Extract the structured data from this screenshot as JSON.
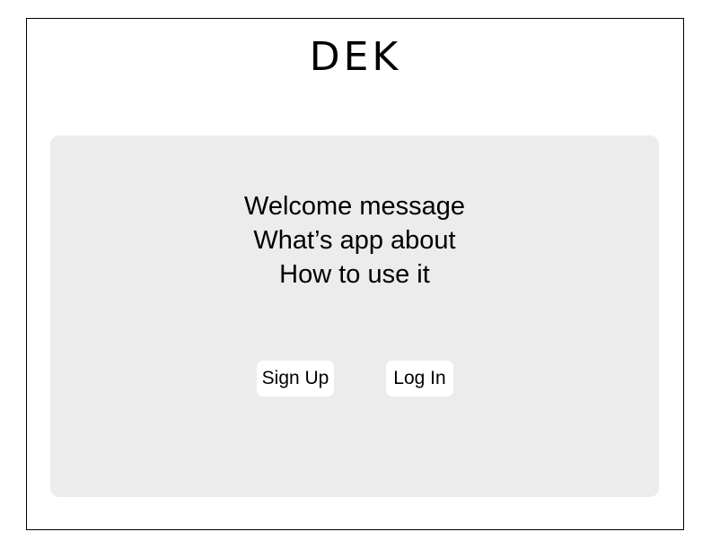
{
  "header": {
    "logo_text": "DEK"
  },
  "main": {
    "lines": [
      "Welcome message",
      "What’s app about",
      "How to use it"
    ],
    "buttons": {
      "sign_up": "Sign Up",
      "log_in": "Log In"
    }
  },
  "colors": {
    "panel_background": "#ececec",
    "button_background": "#ffffff",
    "border": "#000000"
  }
}
